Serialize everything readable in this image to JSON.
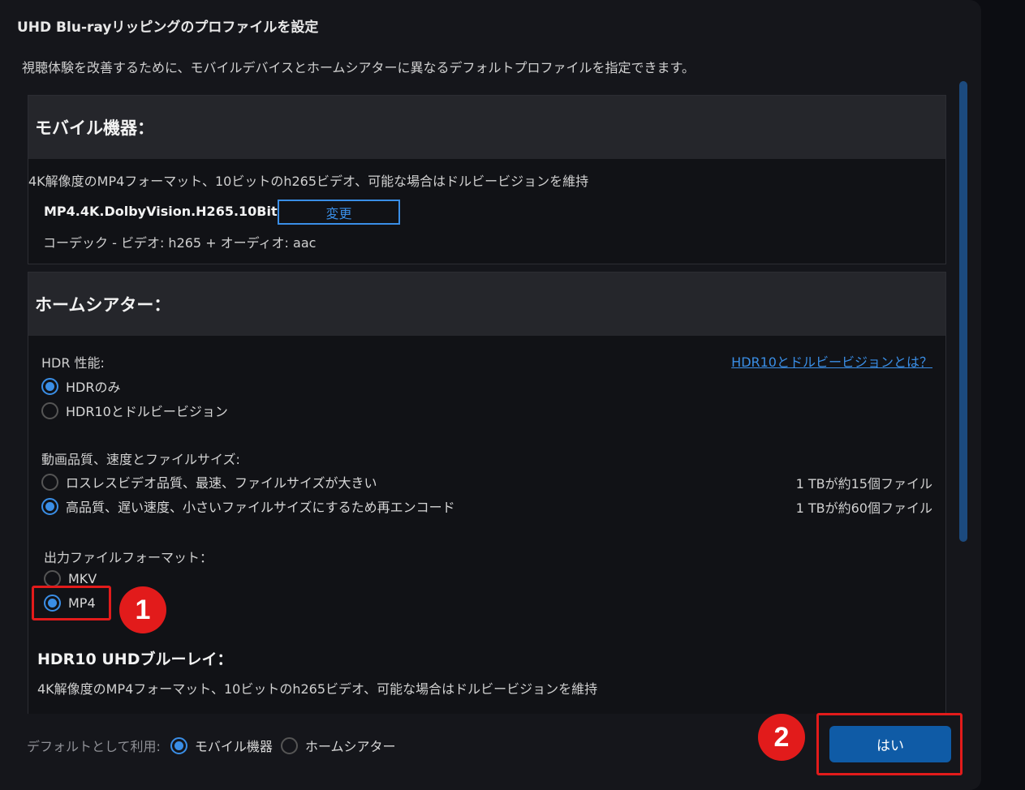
{
  "dialog": {
    "title": "UHD Blu-rayリッピングのプロファイルを設定",
    "description": "視聴体験を改善するために、モバイルデバイスとホームシアターに異なるデフォルトプロファイルを指定できます。"
  },
  "mobile": {
    "heading": "モバイル機器：",
    "summary": "4K解像度のMP4フォーマット、10ビットのh265ビデオ、可能な場合はドルビービジョンを維持",
    "profile_name": "MP4.4K.DolbyVision.H265.10Bit",
    "change_label": "変更",
    "codec": "コーデック - ビデオ: h265 + オーディオ: aac"
  },
  "home": {
    "heading": "ホームシアター：",
    "hdr": {
      "label": "HDR 性能:",
      "help_link": "HDR10とドルビービジョンとは？",
      "options": [
        "HDRのみ",
        "HDR10とドルビービジョン"
      ],
      "selected": 0
    },
    "quality": {
      "label": "動画品質、速度とファイルサイズ:",
      "options": [
        {
          "label": "ロスレスビデオ品質、最速、ファイルサイズが大きい",
          "note": "1 TBが約15個ファイル"
        },
        {
          "label": "高品質、遅い速度、小さいファイルサイズにするため再エンコード",
          "note": "1 TBが約60個ファイル"
        }
      ],
      "selected": 1
    },
    "format": {
      "label": "出力ファイルフォーマット：",
      "options": [
        "MKV",
        "MP4"
      ],
      "selected": 1
    },
    "sub_heading": "HDR10 UHDブルーレイ：",
    "sub_summary": "4K解像度のMP4フォーマット、10ビットのh265ビデオ、可能な場合はドルビービジョンを維持"
  },
  "footer": {
    "default_label": "デフォルトとして利用:",
    "options": [
      "モバイル機器",
      "ホームシアター"
    ],
    "selected": 0,
    "ok_label": "はい"
  },
  "annotations": {
    "step1": "1",
    "step2": "2",
    "color": "#e21b1b"
  },
  "colors": {
    "accent": "#3a8ee6",
    "ok_button": "#0f5ba6",
    "background": "#15161b"
  }
}
